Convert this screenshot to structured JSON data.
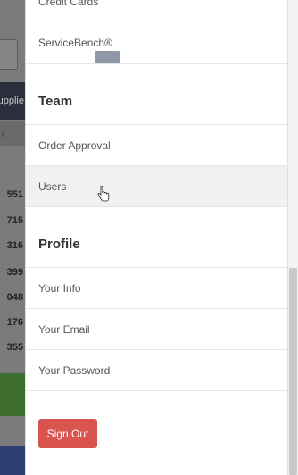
{
  "background_app": {
    "nav_label": "Supplie",
    "row_label": "r",
    "row_numbers": [
      "551",
      "715",
      "316",
      "399",
      "048",
      "176",
      "355"
    ]
  },
  "menu": {
    "items_top": [
      {
        "label": "Credit Cards"
      },
      {
        "label": "ServiceBench®"
      }
    ],
    "team_heading": "Team",
    "team_items": [
      {
        "label": "Order Approval"
      },
      {
        "label": "Users"
      }
    ],
    "profile_heading": "Profile",
    "profile_items": [
      {
        "label": "Your Info"
      },
      {
        "label": "Your Email"
      },
      {
        "label": "Your Password"
      }
    ],
    "sign_out_label": "Sign Out"
  },
  "colors": {
    "sign_out_bg": "#d9534f",
    "hover_bg": "#f1f1f3",
    "overlay": "#7b7b7b"
  }
}
